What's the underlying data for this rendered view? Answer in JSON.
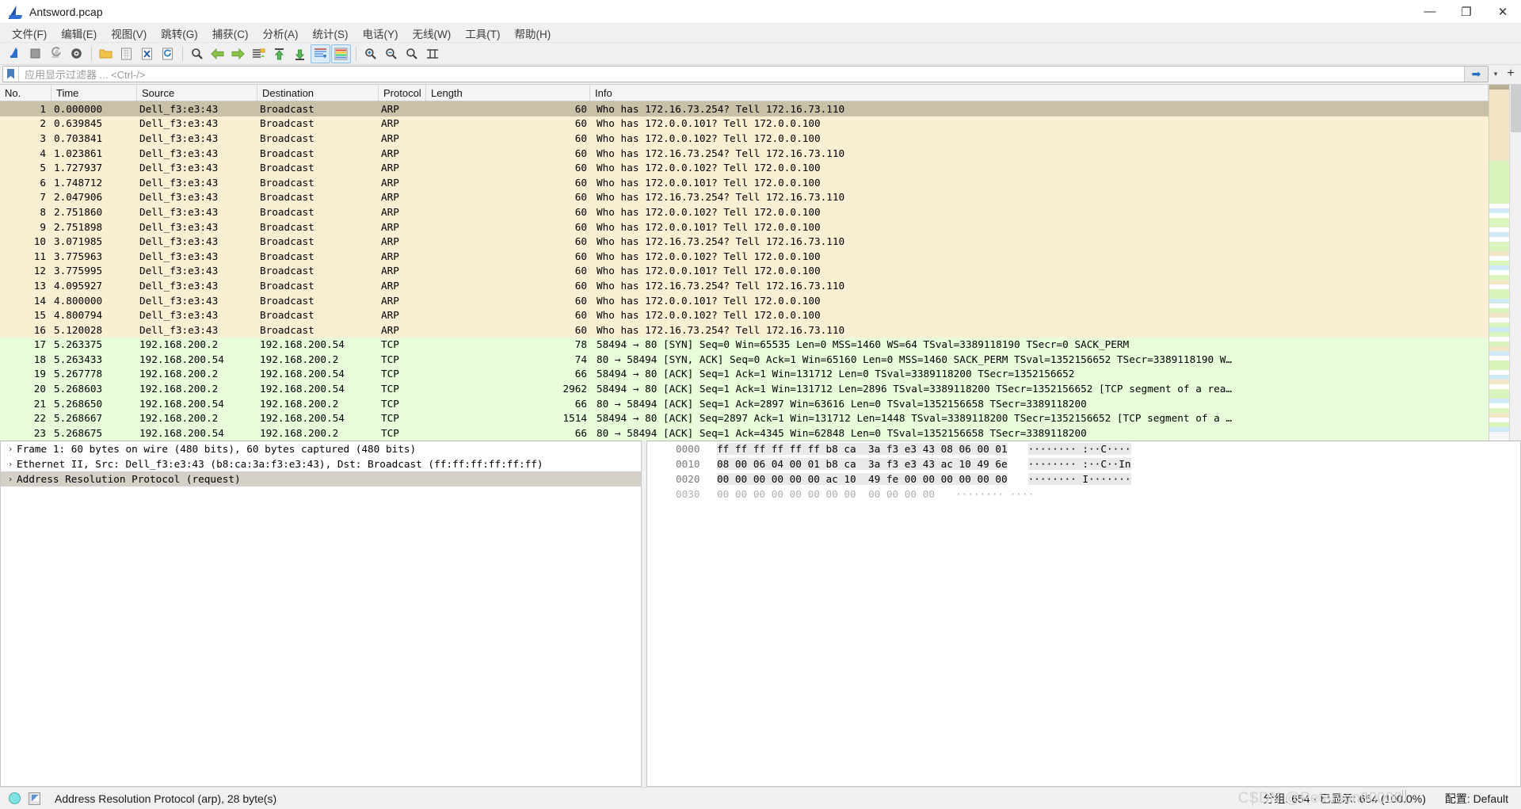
{
  "window": {
    "title": "Antsword.pcap",
    "minimize_label": "—",
    "maximize_label": "❐",
    "close_label": "✕"
  },
  "menu": {
    "items": [
      {
        "label": "文件(F)",
        "name": "menu-file"
      },
      {
        "label": "编辑(E)",
        "name": "menu-edit"
      },
      {
        "label": "视图(V)",
        "name": "menu-view"
      },
      {
        "label": "跳转(G)",
        "name": "menu-go"
      },
      {
        "label": "捕获(C)",
        "name": "menu-capture"
      },
      {
        "label": "分析(A)",
        "name": "menu-analyze"
      },
      {
        "label": "统计(S)",
        "name": "menu-statistics"
      },
      {
        "label": "电话(Y)",
        "name": "menu-telephony"
      },
      {
        "label": "无线(W)",
        "name": "menu-wireless"
      },
      {
        "label": "工具(T)",
        "name": "menu-tools"
      },
      {
        "label": "帮助(H)",
        "name": "menu-help"
      }
    ]
  },
  "toolbar": {
    "buttons": [
      {
        "name": "start-capture-icon",
        "title": "Start"
      },
      {
        "name": "stop-capture-icon",
        "title": "Stop"
      },
      {
        "name": "restart-capture-icon",
        "title": "Restart"
      },
      {
        "name": "capture-options-icon",
        "title": "Capture options"
      },
      {
        "name": "open-file-icon",
        "title": "Open"
      },
      {
        "name": "save-file-icon",
        "title": "Save"
      },
      {
        "name": "close-file-icon",
        "title": "Close"
      },
      {
        "name": "reload-file-icon",
        "title": "Reload"
      },
      {
        "name": "find-packet-icon",
        "title": "Find packet"
      },
      {
        "name": "go-back-icon",
        "title": "Go back"
      },
      {
        "name": "go-forward-icon",
        "title": "Go forward"
      },
      {
        "name": "go-to-packet-icon",
        "title": "Go to packet"
      },
      {
        "name": "go-first-packet-icon",
        "title": "First packet"
      },
      {
        "name": "go-last-packet-icon",
        "title": "Last packet"
      },
      {
        "name": "auto-scroll-icon",
        "title": "Auto scroll"
      },
      {
        "name": "colorize-icon",
        "title": "Colorize"
      },
      {
        "name": "zoom-in-icon",
        "title": "Zoom in"
      },
      {
        "name": "zoom-out-icon",
        "title": "Zoom out"
      },
      {
        "name": "zoom-reset-icon",
        "title": "Normal size"
      },
      {
        "name": "resize-columns-icon",
        "title": "Resize columns"
      }
    ]
  },
  "filter": {
    "placeholder": "应用显示过滤器 ... <Ctrl-/>",
    "value": "",
    "apply_label": "➡",
    "caret_label": "▾",
    "plus_label": "+"
  },
  "packet_list": {
    "columns": [
      {
        "label": "No.",
        "name": "column-no"
      },
      {
        "label": "Time",
        "name": "column-time"
      },
      {
        "label": "Source",
        "name": "column-source"
      },
      {
        "label": "Destination",
        "name": "column-destination"
      },
      {
        "label": "Protocol",
        "name": "column-protocol"
      },
      {
        "label": "Length",
        "name": "column-length"
      },
      {
        "label": "Info",
        "name": "column-info"
      }
    ],
    "rows": [
      {
        "no": "1",
        "time": "0.000000",
        "src": "Dell_f3:e3:43",
        "dst": "Broadcast",
        "proto": "ARP",
        "len": "60",
        "info": "Who has 172.16.73.254? Tell 172.16.73.110",
        "style": "row-sel"
      },
      {
        "no": "2",
        "time": "0.639845",
        "src": "Dell_f3:e3:43",
        "dst": "Broadcast",
        "proto": "ARP",
        "len": "60",
        "info": "Who has 172.0.0.101? Tell 172.0.0.100",
        "style": "row-arp"
      },
      {
        "no": "3",
        "time": "0.703841",
        "src": "Dell_f3:e3:43",
        "dst": "Broadcast",
        "proto": "ARP",
        "len": "60",
        "info": "Who has 172.0.0.102? Tell 172.0.0.100",
        "style": "row-arp"
      },
      {
        "no": "4",
        "time": "1.023861",
        "src": "Dell_f3:e3:43",
        "dst": "Broadcast",
        "proto": "ARP",
        "len": "60",
        "info": "Who has 172.16.73.254? Tell 172.16.73.110",
        "style": "row-arp"
      },
      {
        "no": "5",
        "time": "1.727937",
        "src": "Dell_f3:e3:43",
        "dst": "Broadcast",
        "proto": "ARP",
        "len": "60",
        "info": "Who has 172.0.0.102? Tell 172.0.0.100",
        "style": "row-arp"
      },
      {
        "no": "6",
        "time": "1.748712",
        "src": "Dell_f3:e3:43",
        "dst": "Broadcast",
        "proto": "ARP",
        "len": "60",
        "info": "Who has 172.0.0.101? Tell 172.0.0.100",
        "style": "row-arp"
      },
      {
        "no": "7",
        "time": "2.047906",
        "src": "Dell_f3:e3:43",
        "dst": "Broadcast",
        "proto": "ARP",
        "len": "60",
        "info": "Who has 172.16.73.254? Tell 172.16.73.110",
        "style": "row-arp"
      },
      {
        "no": "8",
        "time": "2.751860",
        "src": "Dell_f3:e3:43",
        "dst": "Broadcast",
        "proto": "ARP",
        "len": "60",
        "info": "Who has 172.0.0.102? Tell 172.0.0.100",
        "style": "row-arp"
      },
      {
        "no": "9",
        "time": "2.751898",
        "src": "Dell_f3:e3:43",
        "dst": "Broadcast",
        "proto": "ARP",
        "len": "60",
        "info": "Who has 172.0.0.101? Tell 172.0.0.100",
        "style": "row-arp"
      },
      {
        "no": "10",
        "time": "3.071985",
        "src": "Dell_f3:e3:43",
        "dst": "Broadcast",
        "proto": "ARP",
        "len": "60",
        "info": "Who has 172.16.73.254? Tell 172.16.73.110",
        "style": "row-arp"
      },
      {
        "no": "11",
        "time": "3.775963",
        "src": "Dell_f3:e3:43",
        "dst": "Broadcast",
        "proto": "ARP",
        "len": "60",
        "info": "Who has 172.0.0.102? Tell 172.0.0.100",
        "style": "row-arp"
      },
      {
        "no": "12",
        "time": "3.775995",
        "src": "Dell_f3:e3:43",
        "dst": "Broadcast",
        "proto": "ARP",
        "len": "60",
        "info": "Who has 172.0.0.101? Tell 172.0.0.100",
        "style": "row-arp"
      },
      {
        "no": "13",
        "time": "4.095927",
        "src": "Dell_f3:e3:43",
        "dst": "Broadcast",
        "proto": "ARP",
        "len": "60",
        "info": "Who has 172.16.73.254? Tell 172.16.73.110",
        "style": "row-arp"
      },
      {
        "no": "14",
        "time": "4.800000",
        "src": "Dell_f3:e3:43",
        "dst": "Broadcast",
        "proto": "ARP",
        "len": "60",
        "info": "Who has 172.0.0.101? Tell 172.0.0.100",
        "style": "row-arp"
      },
      {
        "no": "15",
        "time": "4.800794",
        "src": "Dell_f3:e3:43",
        "dst": "Broadcast",
        "proto": "ARP",
        "len": "60",
        "info": "Who has 172.0.0.102? Tell 172.0.0.100",
        "style": "row-arp"
      },
      {
        "no": "16",
        "time": "5.120028",
        "src": "Dell_f3:e3:43",
        "dst": "Broadcast",
        "proto": "ARP",
        "len": "60",
        "info": "Who has 172.16.73.254? Tell 172.16.73.110",
        "style": "row-arp"
      },
      {
        "no": "17",
        "time": "5.263375",
        "src": "192.168.200.2",
        "dst": "192.168.200.54",
        "proto": "TCP",
        "len": "78",
        "info": "58494 → 80 [SYN] Seq=0 Win=65535 Len=0 MSS=1460 WS=64 TSval=3389118190 TSecr=0 SACK_PERM",
        "style": "row-tcp"
      },
      {
        "no": "18",
        "time": "5.263433",
        "src": "192.168.200.54",
        "dst": "192.168.200.2",
        "proto": "TCP",
        "len": "74",
        "info": "80 → 58494 [SYN, ACK] Seq=0 Ack=1 Win=65160 Len=0 MSS=1460 SACK_PERM TSval=1352156652 TSecr=3389118190 W…",
        "style": "row-tcp"
      },
      {
        "no": "19",
        "time": "5.267778",
        "src": "192.168.200.2",
        "dst": "192.168.200.54",
        "proto": "TCP",
        "len": "66",
        "info": "58494 → 80 [ACK] Seq=1 Ack=1 Win=131712 Len=0 TSval=3389118200 TSecr=1352156652",
        "style": "row-tcp"
      },
      {
        "no": "20",
        "time": "5.268603",
        "src": "192.168.200.2",
        "dst": "192.168.200.54",
        "proto": "TCP",
        "len": "2962",
        "info": "58494 → 80 [ACK] Seq=1 Ack=1 Win=131712 Len=2896 TSval=3389118200 TSecr=1352156652 [TCP segment of a rea…",
        "style": "row-tcp"
      },
      {
        "no": "21",
        "time": "5.268650",
        "src": "192.168.200.54",
        "dst": "192.168.200.2",
        "proto": "TCP",
        "len": "66",
        "info": "80 → 58494 [ACK] Seq=1 Ack=2897 Win=63616 Len=0 TSval=1352156658 TSecr=3389118200",
        "style": "row-tcp"
      },
      {
        "no": "22",
        "time": "5.268667",
        "src": "192.168.200.2",
        "dst": "192.168.200.54",
        "proto": "TCP",
        "len": "1514",
        "info": "58494 → 80 [ACK] Seq=2897 Ack=1 Win=131712 Len=1448 TSval=3389118200 TSecr=1352156652 [TCP segment of a …",
        "style": "row-tcp"
      },
      {
        "no": "23",
        "time": "5.268675",
        "src": "192.168.200.54",
        "dst": "192.168.200.2",
        "proto": "TCP",
        "len": "66",
        "info": "80 → 58494 [ACK] Seq=1 Ack=4345 Win=62848 Len=0 TSval=1352156658 TSecr=3389118200",
        "style": "row-tcp"
      }
    ]
  },
  "packet_detail": {
    "rows": [
      {
        "text": "Frame 1: 60 bytes on wire (480 bits), 60 bytes captured (480 bits)",
        "selected": false,
        "name": "detail-row-frame"
      },
      {
        "text": "Ethernet II, Src: Dell_f3:e3:43 (b8:ca:3a:f3:e3:43), Dst: Broadcast (ff:ff:ff:ff:ff:ff)",
        "selected": false,
        "name": "detail-row-ethernet"
      },
      {
        "text": "Address Resolution Protocol (request)",
        "selected": true,
        "name": "detail-row-arp"
      }
    ]
  },
  "hex_dump": {
    "rows": [
      {
        "offset": "0000",
        "bytes": "ff ff ff ff ff ff b8 ca  3a f3 e3 43 08 06 00 01",
        "ascii": "········ :··C····",
        "dim": false
      },
      {
        "offset": "0010",
        "bytes": "08 00 06 04 00 01 b8 ca  3a f3 e3 43 ac 10 49 6e",
        "ascii": "········ :··C··In",
        "dim": false
      },
      {
        "offset": "0020",
        "bytes": "00 00 00 00 00 00 ac 10  49 fe 00 00 00 00 00 00",
        "ascii": "········ I·······",
        "dim": false
      },
      {
        "offset": "0030",
        "bytes": "00 00 00 00 00 00 00 00  00 00 00 00",
        "ascii": "········ ····",
        "dim": true
      }
    ]
  },
  "status_bar": {
    "left_text": "Address Resolution Protocol (arp), 28 byte(s)",
    "packets_text": "分组: 654 · 已显示: 654 (100.0%)",
    "profile_text": "配置: Default",
    "watermark": "CSDN @Peterson00000"
  },
  "colors": {
    "arp_row": "#faeed3",
    "tcp_row": "#e8feda",
    "selected_row": "#c9c0a8",
    "accent": "#1f6fc4",
    "detail_selected": "#d4d0c8"
  }
}
